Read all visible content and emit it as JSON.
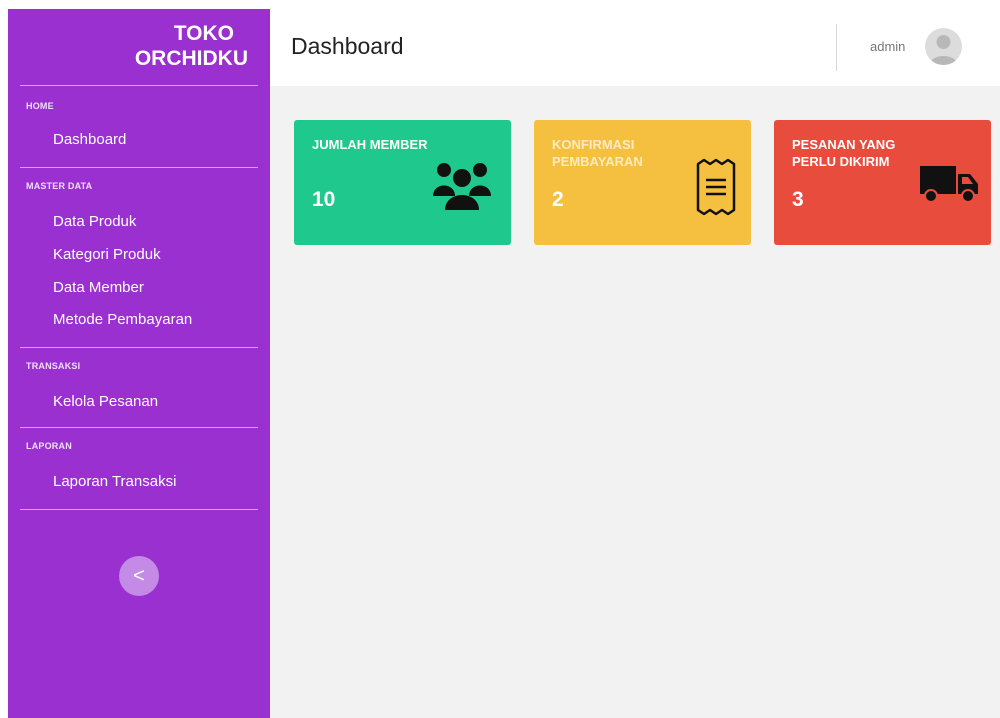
{
  "brand": {
    "line1": "TOKO",
    "line2": "ORCHIDKU"
  },
  "sidebar": {
    "sections": [
      {
        "title": "HOME",
        "items": [
          "Dashboard"
        ]
      },
      {
        "title": "MASTER DATA",
        "items": [
          "Data Produk",
          "Kategori Produk",
          "Data Member",
          "Metode Pembayaran"
        ]
      },
      {
        "title": "TRANSAKSI",
        "items": [
          "Kelola Pesanan"
        ]
      },
      {
        "title": "LAPORAN",
        "items": [
          "Laporan Transaksi"
        ]
      }
    ],
    "collapse_glyph": "<"
  },
  "header": {
    "title": "Dashboard",
    "username": "admin"
  },
  "cards": [
    {
      "title": "JUMLAH MEMBER",
      "value": "10",
      "icon": "users-icon",
      "color": "#1fc98e"
    },
    {
      "title": "KONFIRMASI PEMBAYARAN",
      "value": "2",
      "icon": "receipt-icon",
      "color": "#f5c03f"
    },
    {
      "title": "PESANAN YANG PERLU DIKIRIM",
      "value": "3",
      "icon": "truck-icon",
      "color": "#e74c3c"
    }
  ],
  "colors": {
    "sidebar": "#9a30d0",
    "content_bg": "#f2f2f2"
  }
}
